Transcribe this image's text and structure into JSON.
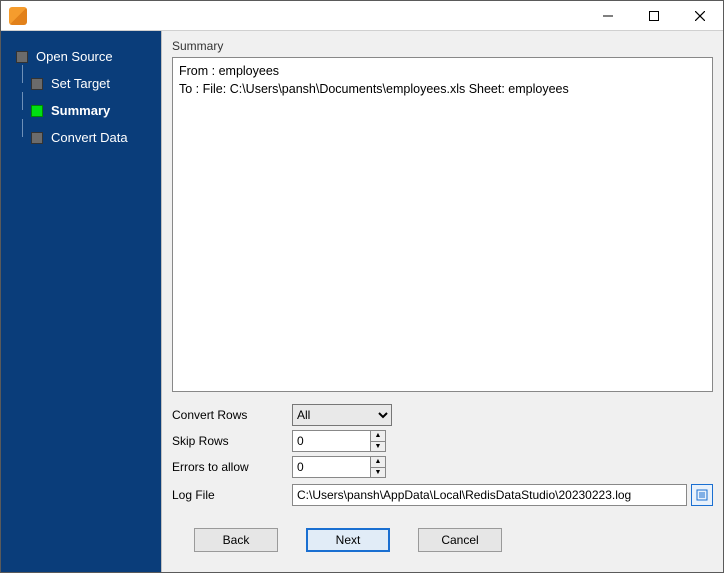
{
  "window": {
    "title": ""
  },
  "sidebar": {
    "items": [
      {
        "label": "Open Source"
      },
      {
        "label": "Set Target"
      },
      {
        "label": "Summary"
      },
      {
        "label": "Convert Data"
      }
    ],
    "current_index": 2
  },
  "section_title": "Summary",
  "summary": {
    "line1": "From : employees",
    "line2": "To : File: C:\\Users\\pansh\\Documents\\employees.xls Sheet: employees"
  },
  "options": {
    "convert_rows": {
      "label": "Convert Rows",
      "selected": "All",
      "choices": [
        "All"
      ]
    },
    "skip_rows": {
      "label": "Skip Rows",
      "value": "0"
    },
    "errors_to_allow": {
      "label": "Errors to allow",
      "value": "0"
    },
    "log_file": {
      "label": "Log File",
      "value": "C:\\Users\\pansh\\AppData\\Local\\RedisDataStudio\\20230223.log"
    }
  },
  "buttons": {
    "back": "Back",
    "next": "Next",
    "cancel": "Cancel"
  }
}
